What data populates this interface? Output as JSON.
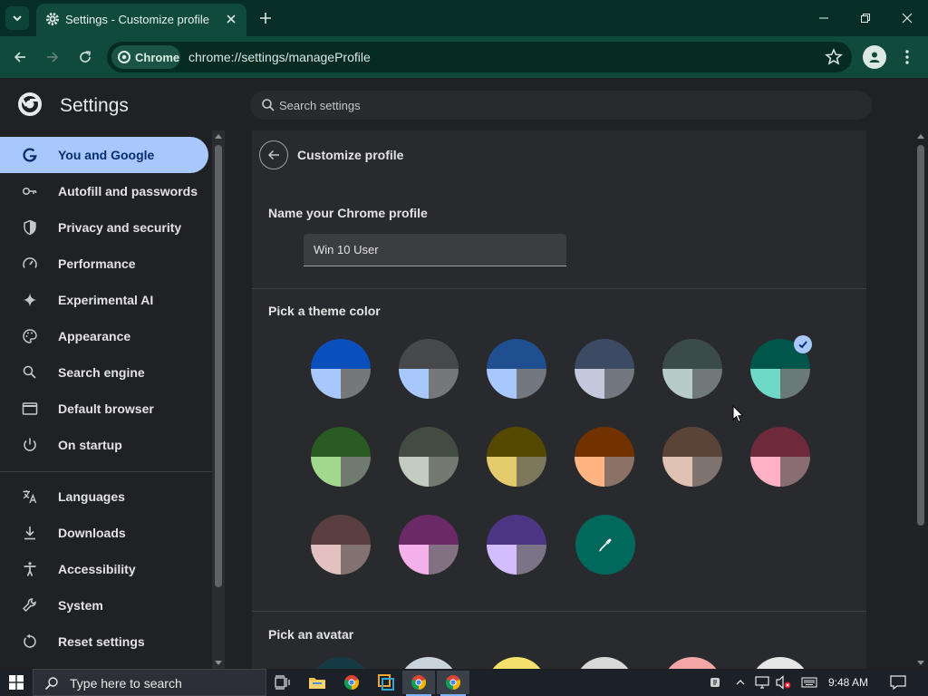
{
  "window": {
    "tab_title": "Settings - Customize profile",
    "url_chip": "Chrome",
    "url": "chrome://settings/manageProfile"
  },
  "settings": {
    "title": "Settings",
    "search_placeholder": "Search settings"
  },
  "sidebar": {
    "items": [
      {
        "label": "You and Google",
        "icon": "google-g-icon",
        "active": true
      },
      {
        "label": "Autofill and passwords",
        "icon": "key-icon"
      },
      {
        "label": "Privacy and security",
        "icon": "shield-icon"
      },
      {
        "label": "Performance",
        "icon": "speedometer-icon"
      },
      {
        "label": "Experimental AI",
        "icon": "sparkle-icon"
      },
      {
        "label": "Appearance",
        "icon": "palette-icon"
      },
      {
        "label": "Search engine",
        "icon": "search-icon"
      },
      {
        "label": "Default browser",
        "icon": "browser-window-icon"
      },
      {
        "label": "On startup",
        "icon": "power-icon"
      }
    ],
    "items2": [
      {
        "label": "Languages",
        "icon": "translate-icon"
      },
      {
        "label": "Downloads",
        "icon": "download-icon"
      },
      {
        "label": "Accessibility",
        "icon": "accessibility-icon"
      },
      {
        "label": "System",
        "icon": "wrench-icon"
      },
      {
        "label": "Reset settings",
        "icon": "reset-icon"
      }
    ]
  },
  "page": {
    "title": "Customize profile",
    "name_label": "Name your Chrome profile",
    "name_value": "Win 10 User",
    "theme_label": "Pick a theme color",
    "avatar_label": "Pick an avatar",
    "selected_theme_index": 5,
    "themes": [
      {
        "top": "#0b4fbd",
        "bl": "#a8c7fa",
        "br": "#757779"
      },
      {
        "top": "#47484a",
        "bl": "#a8c7fa",
        "br": "#757779"
      },
      {
        "top": "#1f4f91",
        "bl": "#a8c7fa",
        "br": "#73777f"
      },
      {
        "top": "#3c4a63",
        "bl": "#c3c9dc",
        "br": "#73777f"
      },
      {
        "top": "#3a4b49",
        "bl": "#b7cbc8",
        "br": "#6f7a78"
      },
      {
        "top": "#00564a",
        "bl": "#6ed9c6",
        "br": "#6a7b77"
      },
      {
        "top": "#285a22",
        "bl": "#a2d88e",
        "br": "#6f7b6c"
      },
      {
        "top": "#434c41",
        "bl": "#c2ccbf",
        "br": "#747a71"
      },
      {
        "top": "#554800",
        "bl": "#e3cb6b",
        "br": "#7d775b"
      },
      {
        "top": "#713200",
        "bl": "#ffb482",
        "br": "#8a7266"
      },
      {
        "top": "#5a4438",
        "bl": "#e0c2b4",
        "br": "#7f736d"
      },
      {
        "top": "#6e2a3a",
        "bl": "#ffb1c5",
        "br": "#886e73"
      },
      {
        "top": "#5a3f3f",
        "bl": "#e2c1c0",
        "br": "#827372"
      },
      {
        "top": "#6b2a67",
        "bl": "#f4b0ea",
        "br": "#827182"
      },
      {
        "top": "#4c3683",
        "bl": "#d3bdff",
        "br": "#7b7488"
      }
    ],
    "custom_color": "#00695c",
    "avatars": [
      "#163a46",
      "#c8d3dc",
      "#f5e06b",
      "#d9d9d9",
      "#f2a6a6",
      "#e6e6e6"
    ]
  },
  "taskbar": {
    "search_placeholder": "Type here to search",
    "time": "9:48 AM"
  }
}
